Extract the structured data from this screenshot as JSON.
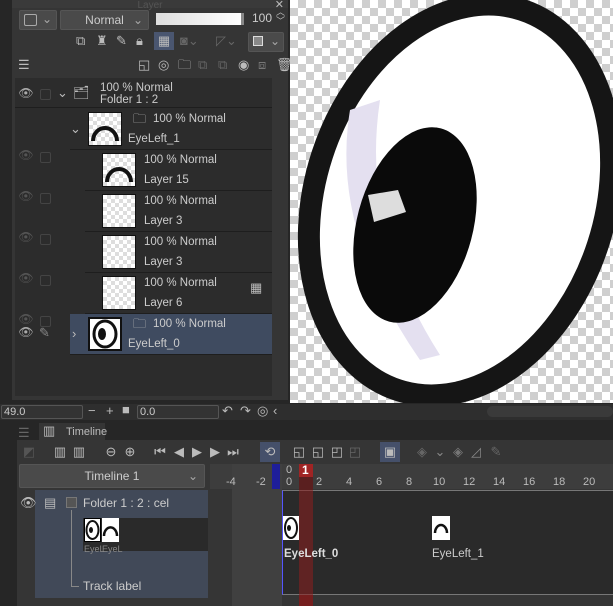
{
  "layer_panel": {
    "title": "Layer",
    "blend_mode": "Normal",
    "opacity": "100",
    "layers": [
      {
        "opacity_mode": "100 % Normal",
        "name": "Folder 1 : 2",
        "type": "animation-folder"
      },
      {
        "opacity_mode": "100 % Normal",
        "name": "EyeLeft_1",
        "type": "folder"
      },
      {
        "opacity_mode": "100 % Normal",
        "name": "Layer 15",
        "type": "raster"
      },
      {
        "opacity_mode": "100 % Normal",
        "name": "Layer 3",
        "type": "raster"
      },
      {
        "opacity_mode": "100 % Normal",
        "name": "Layer 3",
        "type": "raster"
      },
      {
        "opacity_mode": "100 % Normal",
        "name": "Layer 6",
        "type": "raster"
      },
      {
        "opacity_mode": "100 % Normal",
        "name": "EyeLeft_0",
        "type": "folder",
        "selected": true
      }
    ]
  },
  "status": {
    "zoom": "49.0",
    "rotation": "0.0"
  },
  "timeline": {
    "tab_label": "Timeline",
    "selector": "Timeline 1",
    "current_frame": "1",
    "track": "Folder 1 : 2 : cel",
    "track_label": "Track label",
    "mini_cels": [
      "EyeL",
      "EyeL"
    ],
    "ticks_neg": [
      "-4",
      "-2"
    ],
    "ticks": [
      "0",
      "2",
      "4",
      "6",
      "8",
      "10",
      "12",
      "14",
      "16",
      "18",
      "20"
    ],
    "top_zero": "0",
    "cels": [
      {
        "label": "EyeLeft_0",
        "frame": 1
      },
      {
        "label": "EyeLeft_1",
        "frame": 11
      }
    ]
  },
  "colors": {
    "accent": "#3f4b60",
    "playhead": "#a02424",
    "start_marker": "#1e1e9a"
  }
}
